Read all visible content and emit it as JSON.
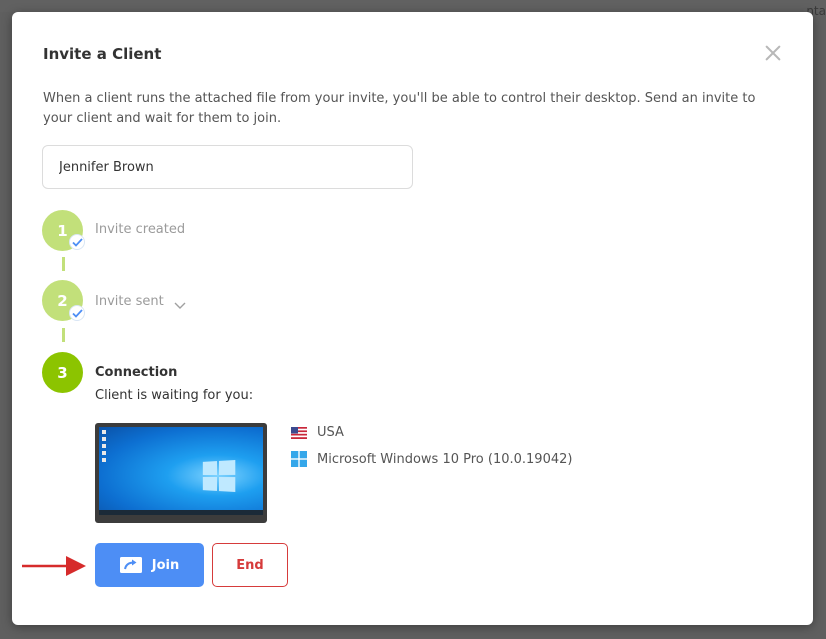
{
  "background": {
    "partial_text": "nta"
  },
  "dialog": {
    "title": "Invite a Client",
    "description": "When a client runs the attached file from your invite, you'll be able to control their desktop. Send an invite to your client and wait for them to join.",
    "client_name_value": "Jennifer Brown",
    "close_icon": "close-icon"
  },
  "steps": [
    {
      "number": "1",
      "label": "Invite created",
      "status": "done"
    },
    {
      "number": "2",
      "label": "Invite sent",
      "status": "done",
      "expand_icon": "chevron-down-icon"
    },
    {
      "number": "3",
      "label": "Connection",
      "status": "active"
    }
  ],
  "connection": {
    "waiting_text": "Client is waiting for you:",
    "country": "USA",
    "country_icon": "us-flag-icon",
    "os": "Microsoft Windows 10 Pro (10.0.19042)",
    "os_icon": "windows-logo-icon"
  },
  "actions": {
    "join_label": "Join",
    "join_icon": "share-screen-icon",
    "end_label": "End"
  },
  "colors": {
    "step_active": "#8cc400",
    "step_done": "#c2e07a",
    "join_button": "#4d8ef5",
    "end_button": "#d63b3b",
    "annotation_arrow": "#d62b2b"
  }
}
